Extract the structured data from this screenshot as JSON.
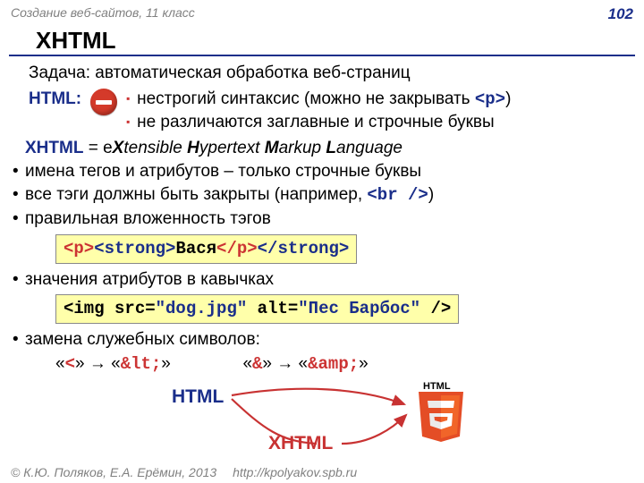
{
  "header": {
    "course": "Создание веб-сайтов, 11 класс",
    "page": "102"
  },
  "title": "XHTML",
  "task": "Задача: автоматическая обработка веб-страниц",
  "html_label": "HTML",
  "html_bullets": {
    "b1_pre": "нестрогий синтаксис (можно не закрывать ",
    "b1_code": "<p>",
    "b1_post": ")",
    "b2": "не различаются заглавные и строчные буквы"
  },
  "xhtml_def": {
    "word": "XHTML",
    "eq": " = e",
    "x": "X",
    "t1": "tensible ",
    "h": "H",
    "t2": "ypertext ",
    "m": "M",
    "t3": "arkup ",
    "l": "L",
    "t4": "anguage"
  },
  "list": {
    "i1": "имена тегов и атрибутов – только строчные буквы",
    "i2_pre": "все тэги должны быть закрыты (например, ",
    "i2_code": "<br />",
    "i2_post": ")",
    "i3": "правильная вложенность тэгов",
    "i4": "значения атрибутов в кавычках",
    "i5": "замена служебных символов:"
  },
  "code1": {
    "a": "<p>",
    "b": "<strong>",
    "c": "Вася",
    "d": "</p>",
    "e": "</strong>"
  },
  "code2": {
    "a": "<img src=",
    "b": "\"dog.jpg\"",
    "c": " alt=",
    "d": "\"Пес Барбос\"",
    "e": " />"
  },
  "entities": {
    "q1": "«",
    "lt": "<",
    "q2": "» → «",
    "lt_ent": "&lt;",
    "q3": "»",
    "amp": "&",
    "amp_ent": "&amp;"
  },
  "diagram": {
    "html": "HTML",
    "xhtml": "XHTML",
    "logo_label": "HTML"
  },
  "footer": {
    "copyright": "© К.Ю. Поляков, Е.А. Ерёмин, 2013",
    "url": "http://kpolyakov.spb.ru"
  }
}
